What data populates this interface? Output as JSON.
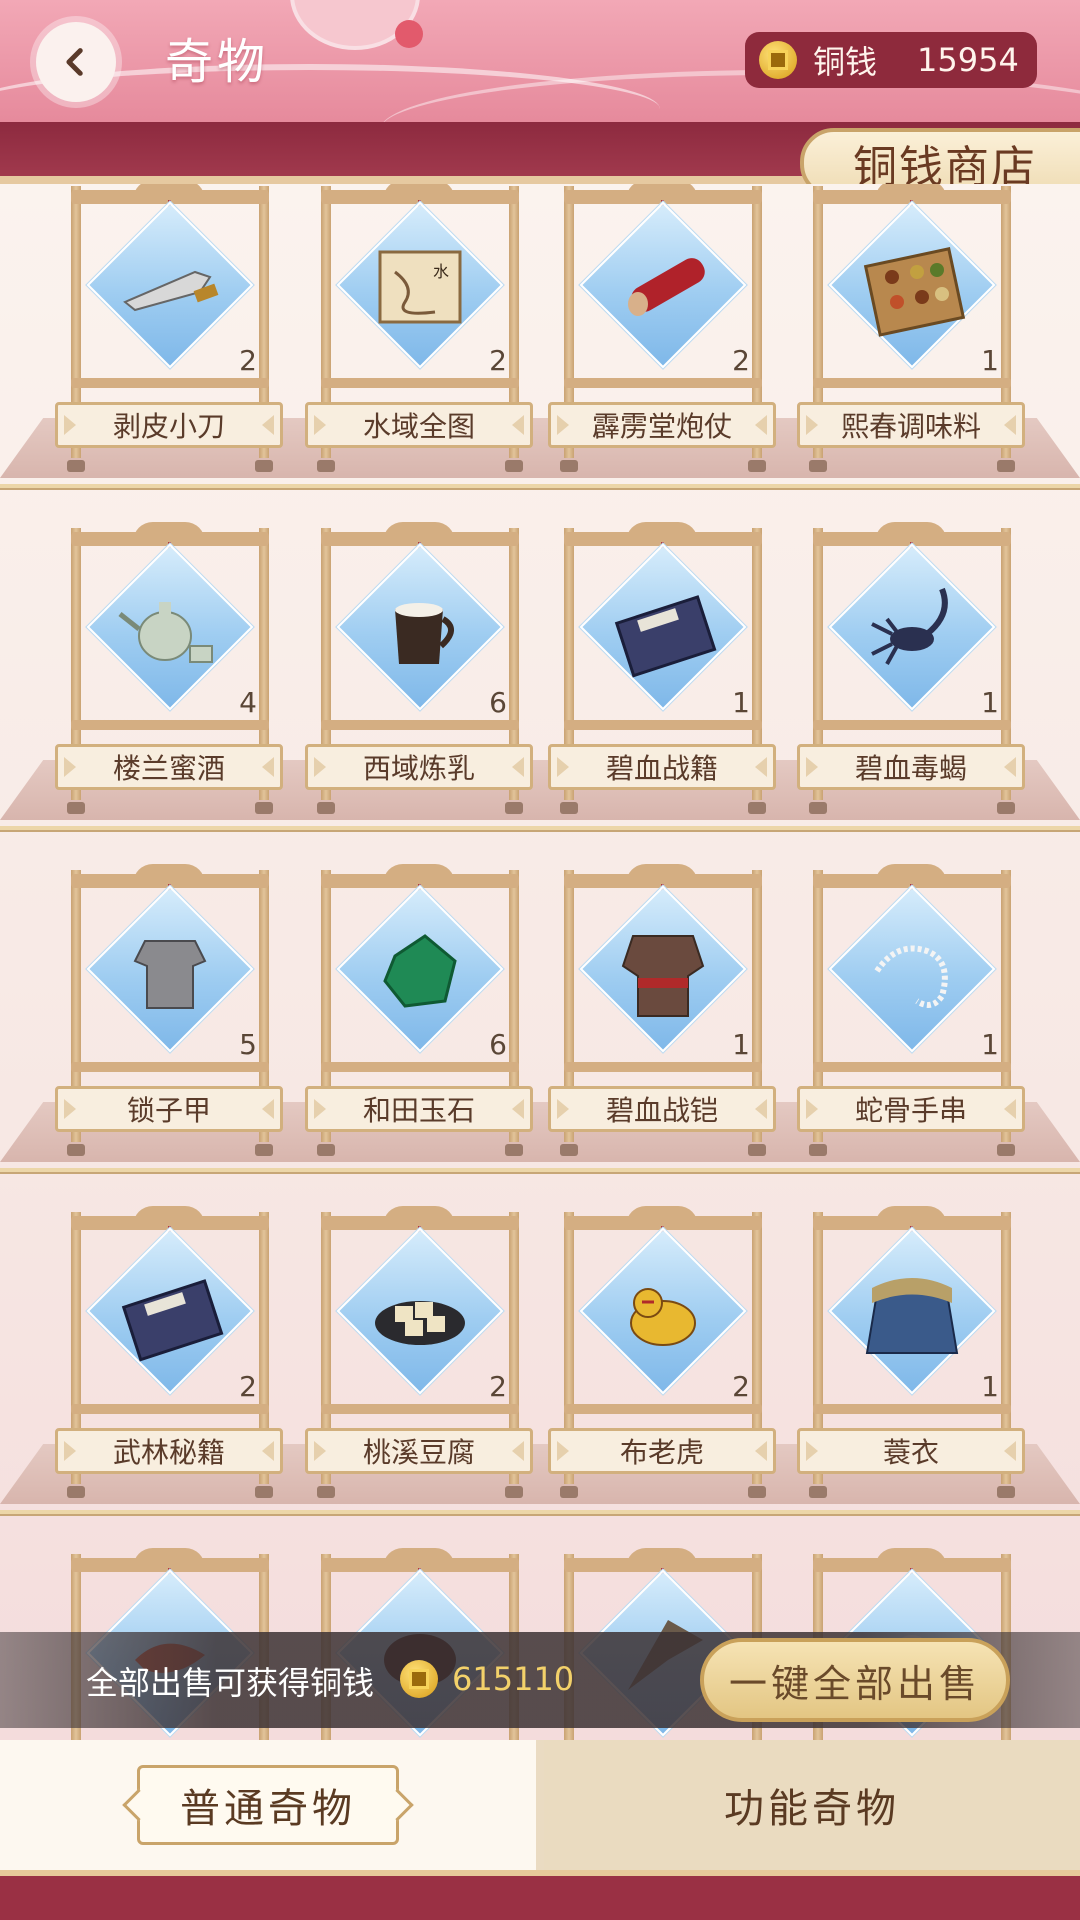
{
  "header": {
    "title": "奇物",
    "currency_label": "铜钱",
    "currency_value": "15954"
  },
  "shop_banner": "铜钱商店",
  "items": [
    {
      "name": "剥皮小刀",
      "count": "2",
      "icon": "knife-icon"
    },
    {
      "name": "水域全图",
      "count": "2",
      "icon": "scroll-map-icon"
    },
    {
      "name": "霹雳堂炮仗",
      "count": "2",
      "icon": "firecracker-icon"
    },
    {
      "name": "熙春调味料",
      "count": "1",
      "icon": "spice-box-icon"
    },
    {
      "name": "楼兰蜜酒",
      "count": "4",
      "icon": "teapot-icon"
    },
    {
      "name": "西域炼乳",
      "count": "6",
      "icon": "milk-jug-icon"
    },
    {
      "name": "碧血战籍",
      "count": "1",
      "icon": "book-icon"
    },
    {
      "name": "碧血毒蝎",
      "count": "1",
      "icon": "scorpion-icon"
    },
    {
      "name": "锁子甲",
      "count": "5",
      "icon": "chainmail-icon"
    },
    {
      "name": "和田玉石",
      "count": "6",
      "icon": "jade-icon"
    },
    {
      "name": "碧血战铠",
      "count": "1",
      "icon": "armor-icon"
    },
    {
      "name": "蛇骨手串",
      "count": "1",
      "icon": "bone-bracelet-icon"
    },
    {
      "name": "武林秘籍",
      "count": "2",
      "icon": "book-icon"
    },
    {
      "name": "桃溪豆腐",
      "count": "2",
      "icon": "tofu-icon"
    },
    {
      "name": "布老虎",
      "count": "2",
      "icon": "cloth-tiger-icon"
    },
    {
      "name": "蓑衣",
      "count": "1",
      "icon": "straw-cape-icon"
    },
    {
      "name": "",
      "count": "",
      "icon": "shrimp-icon"
    },
    {
      "name": "",
      "count": "",
      "icon": "bowl-icon"
    },
    {
      "name": "",
      "count": "",
      "icon": "bat-wing-icon"
    },
    {
      "name": "",
      "count": "",
      "icon": "unknown-icon"
    }
  ],
  "sell_bar": {
    "label": "全部出售可获得铜钱",
    "value": "615110",
    "button": "一键全部出售"
  },
  "tabs": [
    {
      "label": "普通奇物",
      "active": true
    },
    {
      "label": "功能奇物",
      "active": false
    }
  ],
  "colors": {
    "header_pink": "#e68a9c",
    "band_maroon": "#8d2a3f",
    "gold": "#d4ae82",
    "diamond_blue": "#9fcdf1",
    "coin_gold": "#f3d16a"
  }
}
